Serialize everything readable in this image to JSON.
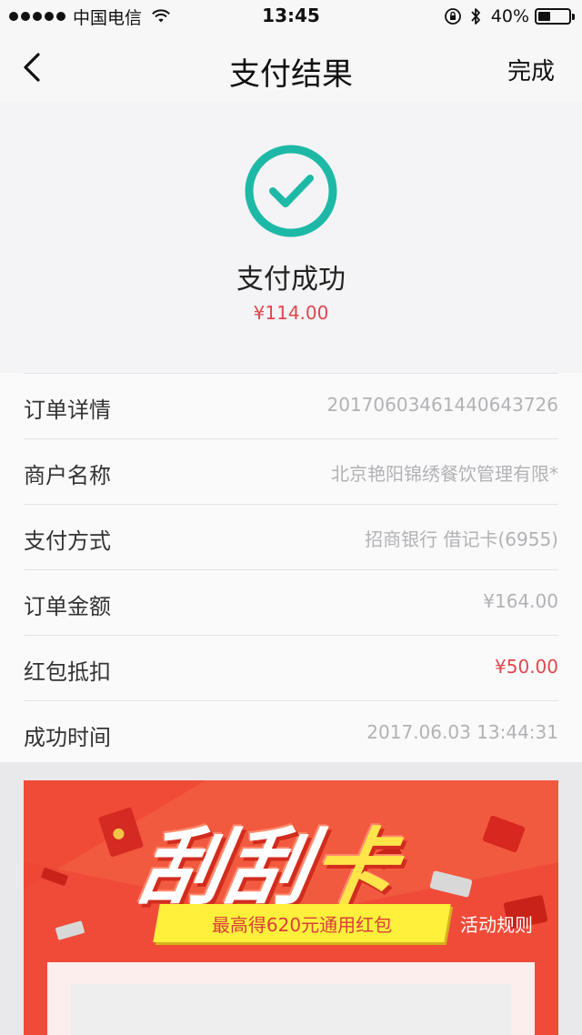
{
  "status_bar": {
    "carrier": "中国电信",
    "time": "13:45",
    "battery_text": "40%",
    "battery_level": 0.4
  },
  "nav": {
    "title": "支付结果",
    "done_label": "完成"
  },
  "result": {
    "title": "支付成功",
    "amount": "¥114.00",
    "check_color": "#1db9a6"
  },
  "details": [
    {
      "label": "订单详情",
      "value": "20170603461440643726",
      "highlight": false
    },
    {
      "label": "商户名称",
      "value": "北京艳阳锦绣餐饮管理有限*",
      "highlight": false
    },
    {
      "label": "支付方式",
      "value": "招商银行 借记卡(6955)",
      "highlight": false
    },
    {
      "label": "订单金额",
      "value": "¥164.00",
      "highlight": false
    },
    {
      "label": "红包抵扣",
      "value": "¥50.00",
      "highlight": true
    },
    {
      "label": "成功时间",
      "value": "2017.06.03 13:44:31",
      "highlight": false
    }
  ],
  "banner": {
    "title_part1": "刮刮",
    "title_part2": "卡",
    "subtitle": "最高得620元通用红包",
    "rules_label": "活动规则"
  },
  "colors": {
    "accent_red": "#e0474e",
    "banner_red": "#f04b39",
    "ribbon_yellow": "#fff03b"
  }
}
